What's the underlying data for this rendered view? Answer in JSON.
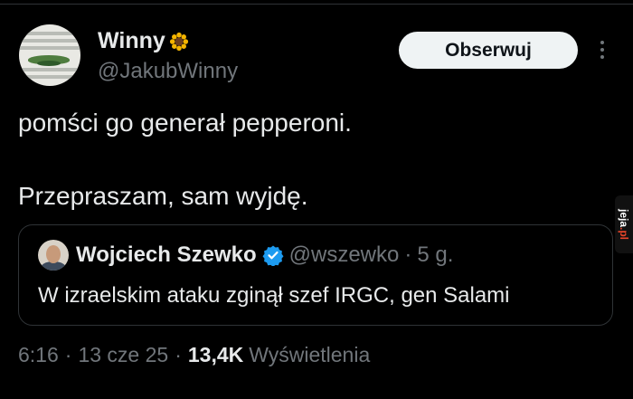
{
  "tweet": {
    "author_name": "Winny",
    "author_emoji": "sunflower-emoji",
    "handle": "@JakubWinny",
    "follow_label": "Obserwuj",
    "text_line1": "pomści go generał pepperoni.",
    "text_line2": "Przepraszam, sam wyjdę."
  },
  "quoted": {
    "author_name": "Wojciech Szewko",
    "handle": "@wszewko",
    "separator": "·",
    "time": "5 g.",
    "text": "W izraelskim ataku zginął szef IRGC, gen Salami"
  },
  "meta": {
    "time": "6:16",
    "sep1": "·",
    "date": "13 cze 25",
    "sep2": "·",
    "views_count": "13,4K",
    "views_label": "Wyświetlenia"
  },
  "watermark": {
    "text": "jeja",
    "suffix": ".pl"
  },
  "colors": {
    "background": "#000000",
    "text": "#e7e9ea",
    "secondary": "#71767b",
    "border": "#2f3336",
    "verified": "#1d9bf0"
  }
}
